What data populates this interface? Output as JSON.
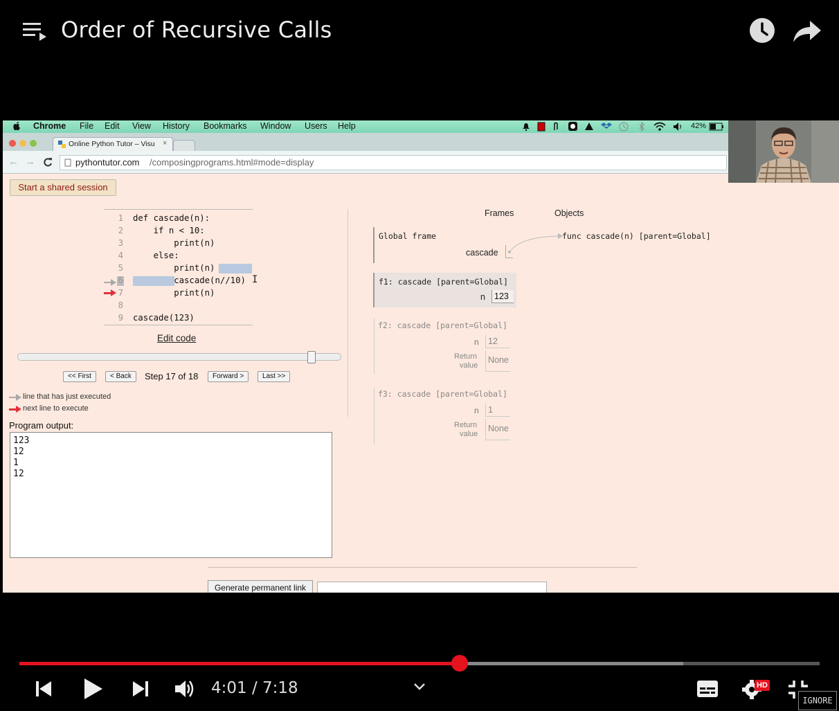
{
  "video": {
    "title": "Order of Recursive Calls",
    "time_current": "4:01",
    "time_separator": " / ",
    "time_total": "7:18",
    "progress": 0.55,
    "buffered": 0.83,
    "hd_badge": "HD",
    "ignore_label": "IGNORE"
  },
  "menubar": {
    "app": "Chrome",
    "items": [
      "File",
      "Edit",
      "View",
      "History",
      "Bookmarks",
      "Window",
      "Users",
      "Help"
    ],
    "battery": "42%"
  },
  "browser": {
    "tab_title": "Online Python Tutor – Visu",
    "url_host": "pythontutor.com",
    "url_path": "/composingprograms.html#mode=display"
  },
  "tutor": {
    "shared_session": "Start a shared session",
    "code": [
      {
        "n": "1",
        "text": "def cascade(n):"
      },
      {
        "n": "2",
        "text": "    if n < 10:"
      },
      {
        "n": "3",
        "text": "        print(n)"
      },
      {
        "n": "4",
        "text": "    else:"
      },
      {
        "n": "5",
        "text": "        print(n)"
      },
      {
        "n": "6",
        "text": "        cascade(n//10)"
      },
      {
        "n": "7",
        "text": "        print(n)"
      },
      {
        "n": "8",
        "text": ""
      },
      {
        "n": "9",
        "text": "cascade(123)"
      }
    ],
    "edit_code": "Edit code",
    "slider": 0.91,
    "btn_first": "<< First",
    "btn_back": "< Back",
    "step_text": "Step 17 of 18",
    "btn_forward": "Forward >",
    "btn_last": "Last >>",
    "legend_executed": "line that has just executed",
    "legend_next": "next line to execute",
    "output_label": "Program output:",
    "output_lines": [
      "123",
      "12",
      "1",
      "12"
    ],
    "perm_link": "Generate permanent link"
  },
  "viz": {
    "frames_header": "Frames",
    "objects_header": "Objects",
    "global_frame": "Global frame",
    "global_var": "cascade",
    "func_obj": "func cascade(n) [parent=Global]",
    "f1": {
      "title": "f1: cascade [parent=Global]",
      "var": "n",
      "val": "123"
    },
    "f2": {
      "title": "f2: cascade [parent=Global]",
      "var": "n",
      "val": "12",
      "ret_label_1": "Return",
      "ret_label_2": "value",
      "ret_val": "None"
    },
    "f3": {
      "title": "f3: cascade [parent=Global]",
      "var": "n",
      "val": "1",
      "ret_label_1": "Return",
      "ret_label_2": "value",
      "ret_val": "None"
    }
  }
}
